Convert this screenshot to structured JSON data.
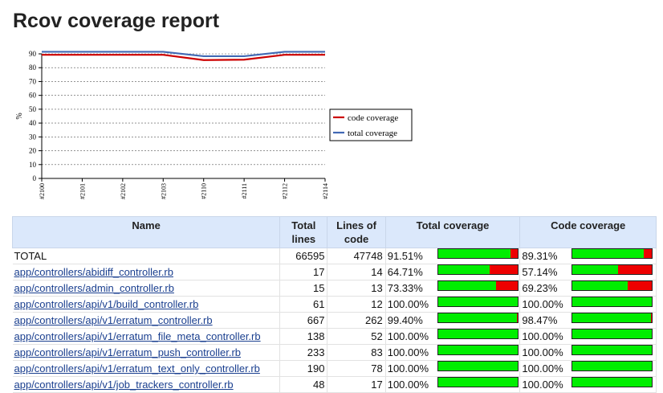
{
  "page": {
    "title": "Rcov coverage report"
  },
  "chart_data": {
    "type": "line",
    "categories": [
      "#2100",
      "#2101",
      "#2102",
      "#2103",
      "#2110",
      "#2111",
      "#2112",
      "#2114"
    ],
    "ylabel": "%",
    "ylim": [
      0,
      90
    ],
    "yticks": [
      0,
      10,
      20,
      30,
      40,
      50,
      60,
      70,
      80,
      90
    ],
    "grid": true,
    "legend_position": "right",
    "series": [
      {
        "name": "code coverage",
        "color": "#cc0000",
        "values": [
          89.3,
          89.3,
          89.3,
          89.3,
          85.5,
          85.8,
          89.3,
          89.3
        ]
      },
      {
        "name": "total coverage",
        "color": "#4169b4",
        "values": [
          91.5,
          91.5,
          91.5,
          91.5,
          88.3,
          88.3,
          91.5,
          91.5
        ]
      }
    ]
  },
  "table": {
    "headers": {
      "name": "Name",
      "total_lines": "Total lines",
      "lines_of_code": "Lines of code",
      "total_coverage": "Total coverage",
      "code_coverage": "Code coverage"
    },
    "rows": [
      {
        "name": "TOTAL",
        "link": false,
        "total_lines": "66595",
        "loc": "47748",
        "total_cov": "91.51%",
        "total_frac": 0.915,
        "code_cov": "89.31%",
        "code_frac": 0.893
      },
      {
        "name": "app/controllers/abidiff_controller.rb",
        "link": true,
        "total_lines": "17",
        "loc": "14",
        "total_cov": "64.71%",
        "total_frac": 0.647,
        "code_cov": "57.14%",
        "code_frac": 0.571
      },
      {
        "name": "app/controllers/admin_controller.rb",
        "link": true,
        "total_lines": "15",
        "loc": "13",
        "total_cov": "73.33%",
        "total_frac": 0.733,
        "code_cov": "69.23%",
        "code_frac": 0.692
      },
      {
        "name": "app/controllers/api/v1/build_controller.rb",
        "link": true,
        "total_lines": "61",
        "loc": "12",
        "total_cov": "100.00%",
        "total_frac": 1.0,
        "code_cov": "100.00%",
        "code_frac": 1.0
      },
      {
        "name": "app/controllers/api/v1/erratum_controller.rb",
        "link": true,
        "total_lines": "667",
        "loc": "262",
        "total_cov": "99.40%",
        "total_frac": 0.994,
        "code_cov": "98.47%",
        "code_frac": 0.985
      },
      {
        "name": "app/controllers/api/v1/erratum_file_meta_controller.rb",
        "link": true,
        "total_lines": "138",
        "loc": "52",
        "total_cov": "100.00%",
        "total_frac": 1.0,
        "code_cov": "100.00%",
        "code_frac": 1.0
      },
      {
        "name": "app/controllers/api/v1/erratum_push_controller.rb",
        "link": true,
        "total_lines": "233",
        "loc": "83",
        "total_cov": "100.00%",
        "total_frac": 1.0,
        "code_cov": "100.00%",
        "code_frac": 1.0
      },
      {
        "name": "app/controllers/api/v1/erratum_text_only_controller.rb",
        "link": true,
        "total_lines": "190",
        "loc": "78",
        "total_cov": "100.00%",
        "total_frac": 1.0,
        "code_cov": "100.00%",
        "code_frac": 1.0
      },
      {
        "name": "app/controllers/api/v1/job_trackers_controller.rb",
        "link": true,
        "total_lines": "48",
        "loc": "17",
        "total_cov": "100.00%",
        "total_frac": 1.0,
        "code_cov": "100.00%",
        "code_frac": 1.0
      }
    ]
  }
}
